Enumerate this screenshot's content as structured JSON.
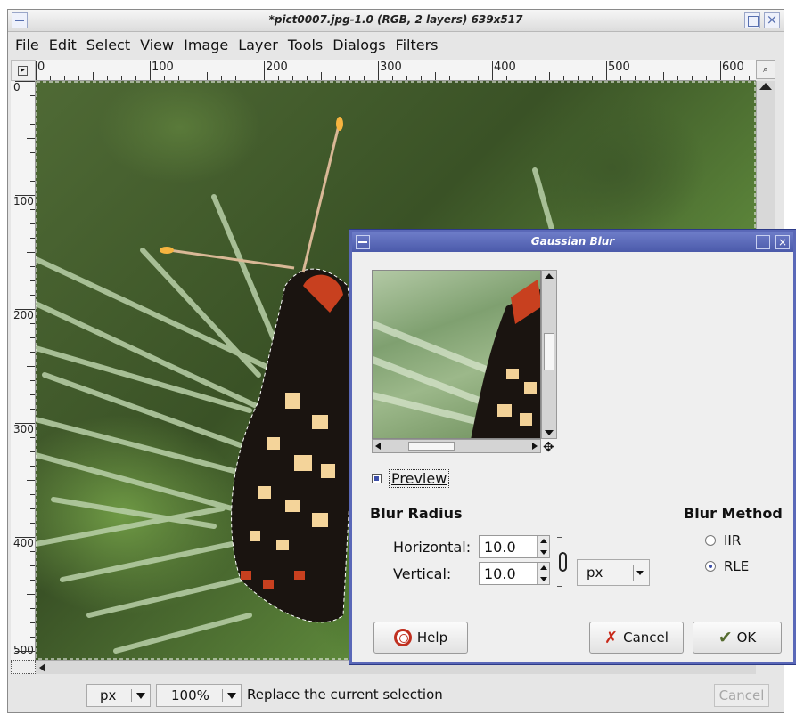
{
  "window": {
    "title": "*pict0007.jpg-1.0 (RGB, 2 layers) 639x517"
  },
  "menubar": {
    "items": [
      "File",
      "Edit",
      "Select",
      "View",
      "Image",
      "Layer",
      "Tools",
      "Dialogs",
      "Filters"
    ]
  },
  "ruler": {
    "h_labels": [
      "0",
      "100",
      "200",
      "300",
      "400",
      "500",
      "600"
    ],
    "v_labels": [
      "0",
      "100",
      "200",
      "300",
      "400",
      "500"
    ]
  },
  "statusbar": {
    "unit": "px",
    "zoom": "100%",
    "message": "Replace the current selection",
    "cancel_label": "Cancel"
  },
  "dialog": {
    "title": "Gaussian Blur",
    "preview_label": "Preview",
    "preview_checked": true,
    "blur_radius_heading": "Blur Radius",
    "horizontal_label": "Horizontal:",
    "horizontal_value": "10.0",
    "vertical_label": "Vertical:",
    "vertical_value": "10.0",
    "unit": "px",
    "blur_method_heading": "Blur Method",
    "methods": [
      {
        "label": "IIR",
        "selected": false
      },
      {
        "label": "RLE",
        "selected": true
      }
    ],
    "help_label": "Help",
    "cancel_label": "Cancel",
    "ok_label": "OK"
  },
  "colors": {
    "dialog_border": "#5a68b8",
    "accent": "#3c4ea8"
  }
}
